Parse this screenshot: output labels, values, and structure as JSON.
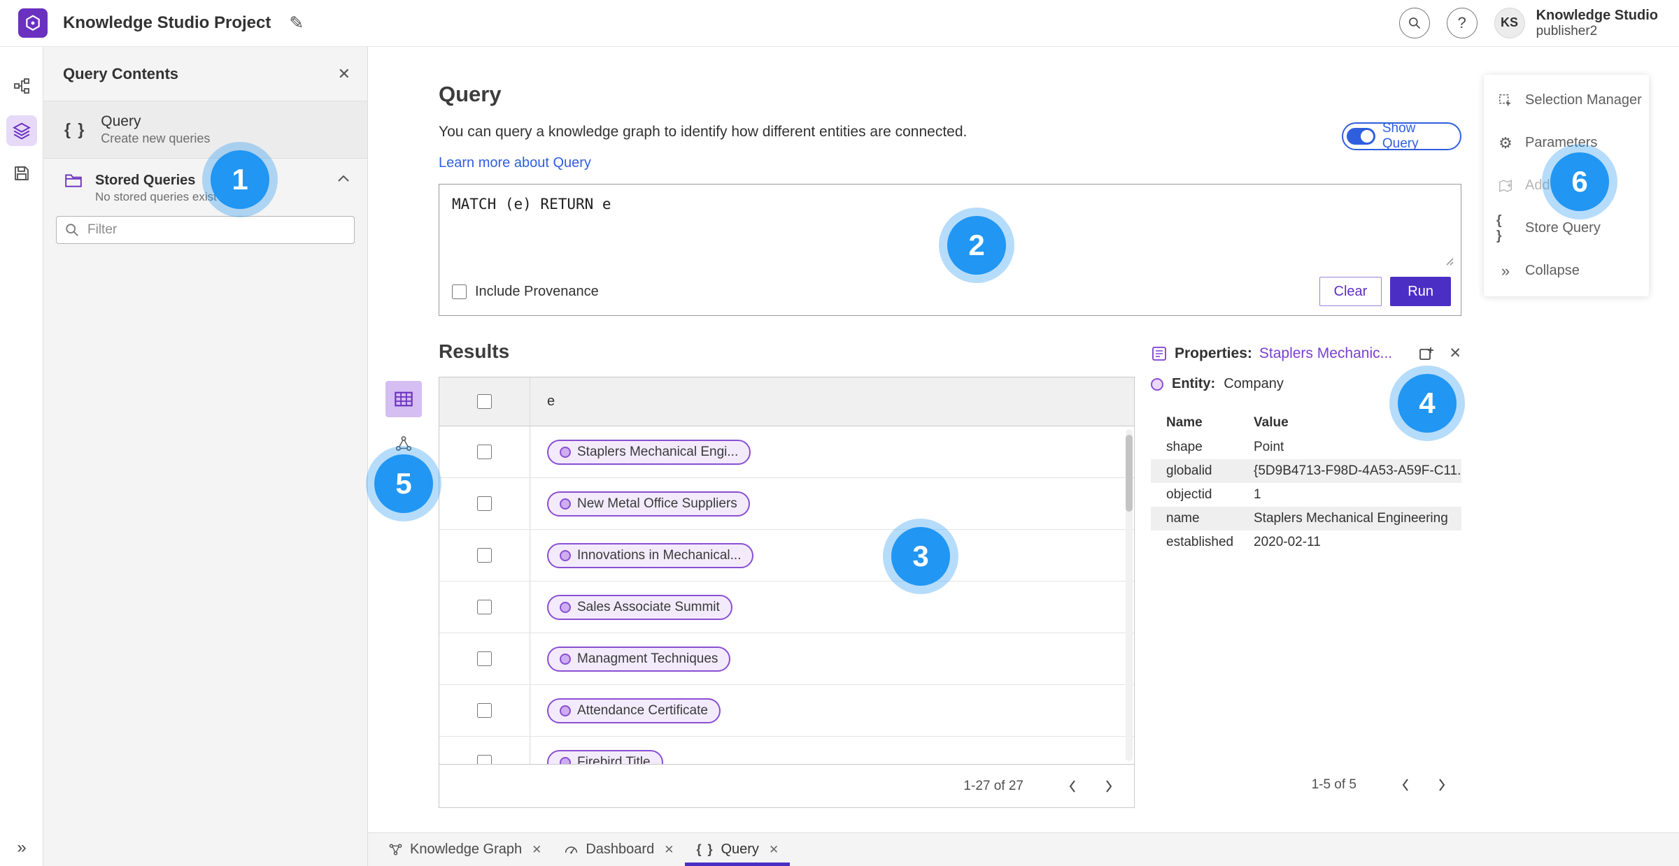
{
  "colors": {
    "accent_purple": "#6a30c0",
    "run_button_purple": "#4b2fc5",
    "link_blue": "#2f5fde",
    "badge_blue": "#2196f3",
    "chip_border_purple": "#8a4fd3",
    "active_tab_underline": "#4b2fc5"
  },
  "icons": {
    "pencil": "✎",
    "question": "?",
    "close": "✕",
    "braces": "{ }",
    "gear": "⚙",
    "collapse_right": "»"
  },
  "topbar": {
    "title": "Knowledge Studio Project",
    "user_initials": "KS",
    "user_name": "Knowledge Studio",
    "user_role": "publisher2"
  },
  "left_panel": {
    "title": "Query Contents",
    "query_item_label": "Query",
    "query_item_sublabel": "Create new queries",
    "stored_queries_label": "Stored Queries",
    "stored_queries_empty": "No stored queries exist",
    "filter_placeholder": "Filter"
  },
  "query": {
    "title": "Query",
    "description": "You can query a knowledge graph to identify how different entities are connected.",
    "learn_more": "Learn more about Query",
    "show_query": "Show Query",
    "code": "MATCH (e) RETURN e",
    "include_provenance": "Include Provenance",
    "clear": "Clear",
    "run": "Run"
  },
  "results": {
    "title": "Results",
    "column": "e",
    "rows": [
      "Staplers Mechanical Engi...",
      "New Metal Office Suppliers",
      "Innovations in Mechanical...",
      "Sales Associate Summit",
      "Managment Techniques",
      "Attendance Certificate",
      "Firebird Title"
    ],
    "pagination": "1-27 of 27"
  },
  "properties": {
    "label": "Properties:",
    "entity_link": "Staplers Mechanic...",
    "entity_label": "Entity:",
    "entity_type": "Company",
    "col_name": "Name",
    "col_value": "Value",
    "rows": [
      {
        "name": "shape",
        "value": "Point"
      },
      {
        "name": "globalid",
        "value": "{5D9B4713-F98D-4A53-A59F-C11..."
      },
      {
        "name": "objectid",
        "value": "1"
      },
      {
        "name": "name",
        "value": "Staplers Mechanical Engineering"
      },
      {
        "name": "established",
        "value": "2020-02-11"
      }
    ],
    "pagination": "1-5 of 5"
  },
  "right_menu": {
    "selection_manager": "Selection Manager",
    "parameters": "Parameters",
    "add_to_map": "Add To Map",
    "store_query": "Store Query",
    "collapse": "Collapse"
  },
  "tabs": {
    "knowledge_graph": "Knowledge Graph",
    "dashboard": "Dashboard",
    "query": "Query"
  },
  "badges": {
    "b1": "1",
    "b2": "2",
    "b3": "3",
    "b4": "4",
    "b5": "5",
    "b6": "6"
  }
}
